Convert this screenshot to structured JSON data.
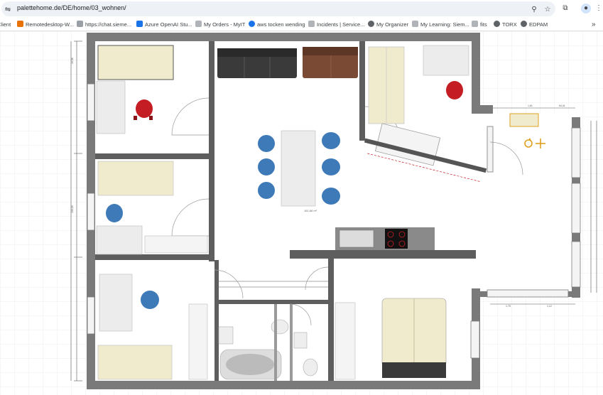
{
  "browser": {
    "url": "palettehome.de/DE/home/03_wohnen/",
    "bookmarks": [
      {
        "label": "Client",
        "color": "#5f6368"
      },
      {
        "label": "Remotedesktop-W...",
        "color": "#e8710a"
      },
      {
        "label": "https://chat.sieme...",
        "color": "#9aa0a6"
      },
      {
        "label": "Azure OpenAI Stu...",
        "color": "#1a73e8"
      },
      {
        "label": "My Orders - MyIT",
        "color": "#b0b3b8"
      },
      {
        "label": "aws tocken wending",
        "color": "#1a73e8"
      },
      {
        "label": "Incidents | Service...",
        "color": "#b0b3b8"
      },
      {
        "label": "My Organizer",
        "color": "#5f6368"
      },
      {
        "label": "My Learning: Siem...",
        "color": "#b0b3b8"
      },
      {
        "label": "fits",
        "color": "#b0b3b8"
      },
      {
        "label": "TORX",
        "color": "#5f6368"
      },
      {
        "label": "EDPAM",
        "color": "#5f6368"
      }
    ]
  },
  "plan": {
    "colors": {
      "wall": "#7a7a7a",
      "wall_dark": "#555555",
      "floor": "#ffffff",
      "grid": "#eeeeee",
      "chair_red": "#c41e24",
      "chair_blue": "#3f7ab8",
      "bed": "#f0ebcc",
      "sofa_dark": "#3a3a3a",
      "sofa_brown": "#7a4a35",
      "rotate_handle": "#e0a020"
    },
    "labels": {
      "area": "161,66 m²"
    }
  }
}
